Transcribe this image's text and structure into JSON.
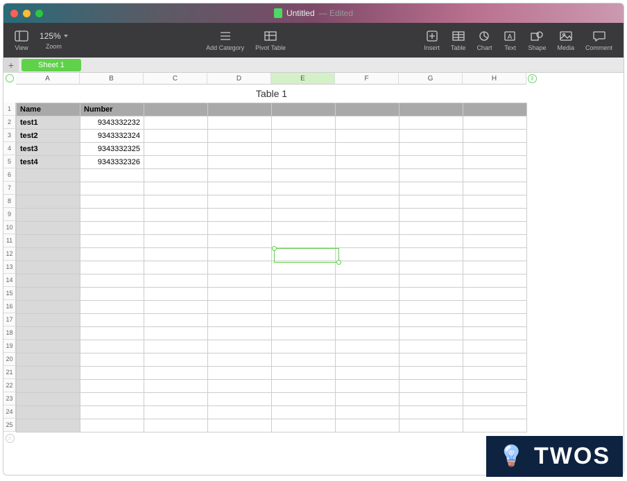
{
  "titlebar": {
    "doc_name": "Untitled",
    "status": "Edited"
  },
  "toolbar": {
    "view": "View",
    "zoom": "Zoom",
    "zoom_value": "125%",
    "add_category": "Add Category",
    "pivot": "Pivot Table",
    "insert": "Insert",
    "table": "Table",
    "chart": "Chart",
    "text": "Text",
    "shape": "Shape",
    "media": "Media",
    "comment": "Comment"
  },
  "sheets": {
    "active": "Sheet 1"
  },
  "table": {
    "title": "Table 1",
    "columns": [
      "A",
      "B",
      "C",
      "D",
      "E",
      "F",
      "G",
      "H"
    ],
    "headers": {
      "A": "Name",
      "B": "Number"
    },
    "rows": [
      {
        "n": "1",
        "A": "",
        "B": ""
      },
      {
        "n": "2",
        "A": "Name",
        "B": "Number"
      },
      {
        "n": "3",
        "A": "test1",
        "B": "9343332232"
      },
      {
        "n": "4",
        "A": "test2",
        "B": "9343332324"
      },
      {
        "n": "5",
        "A": "test3",
        "B": "9343332325"
      },
      {
        "n": "6",
        "A": "test4",
        "B": "9343332326"
      }
    ],
    "selected_cell": "E12",
    "selected_column": "E",
    "visible_row_count": 25
  },
  "watermark": {
    "text": "TWOS"
  }
}
